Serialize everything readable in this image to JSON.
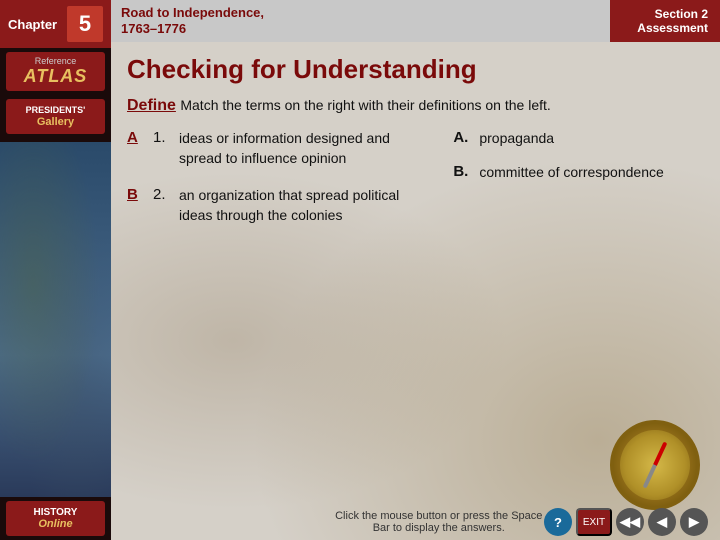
{
  "sidebar": {
    "chapter_label": "Chapter",
    "chapter_number": "5",
    "atlas": {
      "reference_label": "Reference",
      "title": "ATLAS"
    },
    "presidents": {
      "label": "PRESIDENTS'",
      "gallery": "Gallery"
    },
    "history": {
      "label": "HISTORY",
      "online": "Online"
    }
  },
  "header": {
    "road_line1": "Road to Independence,",
    "road_line2": "1763–1776",
    "section_line1": "Section 2",
    "section_line2": "Assessment"
  },
  "content": {
    "title": "Checking for Understanding",
    "define_intro": "Match the terms on the right with their definitions on the left.",
    "define_word": "Define",
    "items": [
      {
        "letter": "A",
        "number": "1.",
        "text": "ideas or information designed and spread to influence opinion"
      },
      {
        "letter": "B",
        "number": "2.",
        "text": "an organization that spread political ideas through the colonies"
      }
    ],
    "answers": [
      {
        "letter": "A.",
        "text": "propaganda"
      },
      {
        "letter": "B.",
        "text": "committee of correspondence"
      }
    ],
    "instruction": "Click the mouse button or press the Space Bar to display the answers."
  },
  "bottom": {
    "question_btn": "?",
    "exit_btn": "EXIT",
    "prev_prev_btn": "◀◀",
    "prev_btn": "◀",
    "next_btn": "▶"
  }
}
